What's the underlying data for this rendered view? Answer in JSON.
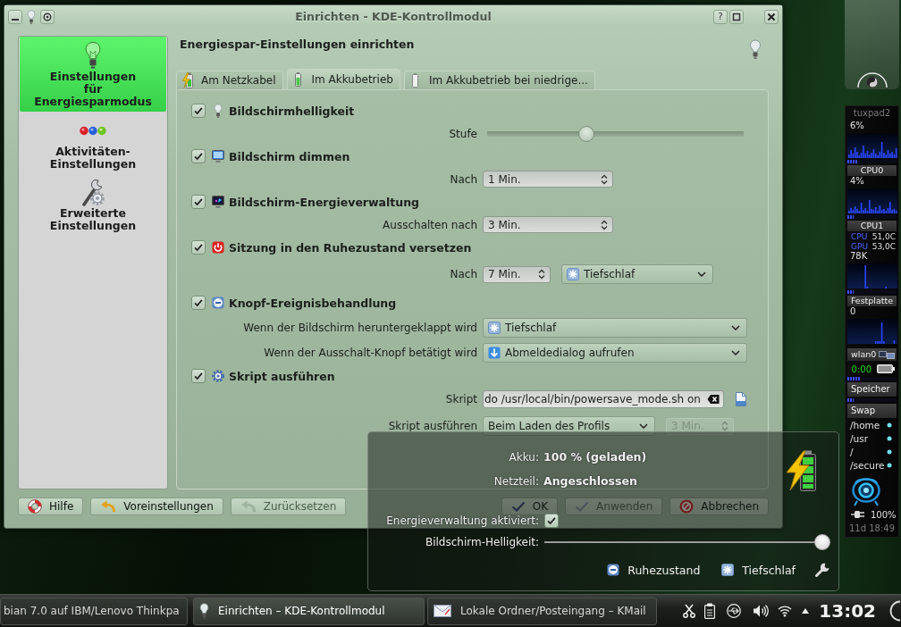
{
  "window": {
    "title": "Einrichten - KDE-Kontrollmodul",
    "help_button": "?"
  },
  "sidebar": {
    "items": [
      {
        "label": "Einstellungen\nfür\nEnergiesparmodus",
        "selected": true
      },
      {
        "label": "Aktivitäten-\nEinstellungen",
        "selected": false
      },
      {
        "label": "Erweiterte\nEinstellungen",
        "selected": false
      }
    ]
  },
  "page": {
    "heading": "Energiespar-Einstellungen einrichten"
  },
  "tabs": [
    {
      "label": "Am Netzkabel",
      "selected": false
    },
    {
      "label": "Im Akkubetrieb",
      "selected": true
    },
    {
      "label": "Im Akkubetrieb bei niedrige...",
      "selected": false
    }
  ],
  "sections": [
    {
      "label": "Bildschirmhelligkeit",
      "checked": true,
      "settings": [
        {
          "kind": "slider",
          "label": "Stufe",
          "level": 0.38
        }
      ]
    },
    {
      "label": "Bildschirm dimmen",
      "checked": true,
      "settings": [
        {
          "kind": "spin",
          "label": "Nach",
          "value": "1 Min."
        }
      ]
    },
    {
      "label": "Bildschirm-Energieverwaltung",
      "checked": true,
      "settings": [
        {
          "kind": "spin",
          "label": "Ausschalten nach",
          "value": "3 Min."
        }
      ]
    },
    {
      "label": "Sitzung in den Ruhezustand versetzen",
      "checked": true,
      "settings": [
        {
          "kind": "spin_combo",
          "label": "Nach",
          "value": "7 Min.",
          "option": "Tiefschlaf"
        }
      ]
    },
    {
      "label": "Knopf-Ereignisbehandlung",
      "checked": true,
      "settings": [
        {
          "kind": "combo",
          "label": "Wenn der Bildschirm heruntergeklappt wird",
          "value": "Tiefschlaf"
        },
        {
          "kind": "combo",
          "label": "Wenn der Ausschalt-Knopf betätigt wird",
          "value": "Abmeldedialog aufrufen"
        }
      ]
    },
    {
      "label": "Skript ausführen",
      "checked": true,
      "settings": [
        {
          "kind": "text",
          "label": "Skript",
          "value": "do /usr/local/bin/powersave_mode.sh on"
        },
        {
          "kind": "combo_spin",
          "label": "Skript ausführen",
          "value": "Beim Laden des Profils",
          "spin": "3 Min.",
          "spin_disabled": true
        }
      ]
    }
  ],
  "buttons": {
    "left": [
      {
        "label": "Hilfe",
        "disabled": false
      },
      {
        "label": "Voreinstellungen",
        "disabled": false
      },
      {
        "label": "Zurücksetzen",
        "disabled": true
      }
    ],
    "right": [
      {
        "label": "OK",
        "disabled": false
      },
      {
        "label": "Anwenden",
        "disabled": true
      },
      {
        "label": "Abbrechen",
        "disabled": false
      }
    ]
  },
  "battery_popup": {
    "rows": [
      {
        "label": "Akku:",
        "value": "100 % (geladen)"
      },
      {
        "label": "Netzteil:",
        "value": "Angeschlossen"
      }
    ],
    "power_management": {
      "label": "Energieverwaltung aktiviert:",
      "checked": true
    },
    "brightness": {
      "label": "Bildschirm-Helligkeit:",
      "level": 1
    },
    "actions": [
      "Ruhezustand",
      "Tiefschlaf"
    ]
  },
  "system_monitor": {
    "host": "tuxpad2",
    "cpus": [
      {
        "reading": "6%",
        "level": 0.22,
        "name": "CPU0"
      },
      {
        "reading": "4%",
        "level": 0.13,
        "name": "CPU1"
      }
    ],
    "temperatures": [
      {
        "label": "CPU",
        "value": "51,0C"
      },
      {
        "label": "GPU",
        "value": "53,0C"
      }
    ],
    "disk": {
      "reading": "78K",
      "level": 0.13,
      "name": "Festplatte"
    },
    "network": {
      "reading": "0",
      "name": "wlan0"
    },
    "battery_time": "0:00",
    "memory": [
      {
        "level": 0.26,
        "name": "Speicher"
      },
      {
        "level": 0.13,
        "name": "Swap"
      }
    ],
    "mounts": [
      "/home",
      "/usr",
      "/",
      "/secure"
    ],
    "power": "100%",
    "uptime": "11d 18:49"
  },
  "taskbar": {
    "tasks": [
      {
        "label": "bian 7.0 auf IBM/Lenovo Thinkpa",
        "selected": false
      },
      {
        "label": "Einrichten – KDE-Kontrollmodul",
        "selected": true
      },
      {
        "label": "Lokale Ordner/Posteingang – KMail",
        "selected": false
      }
    ],
    "clock": "13:02"
  }
}
